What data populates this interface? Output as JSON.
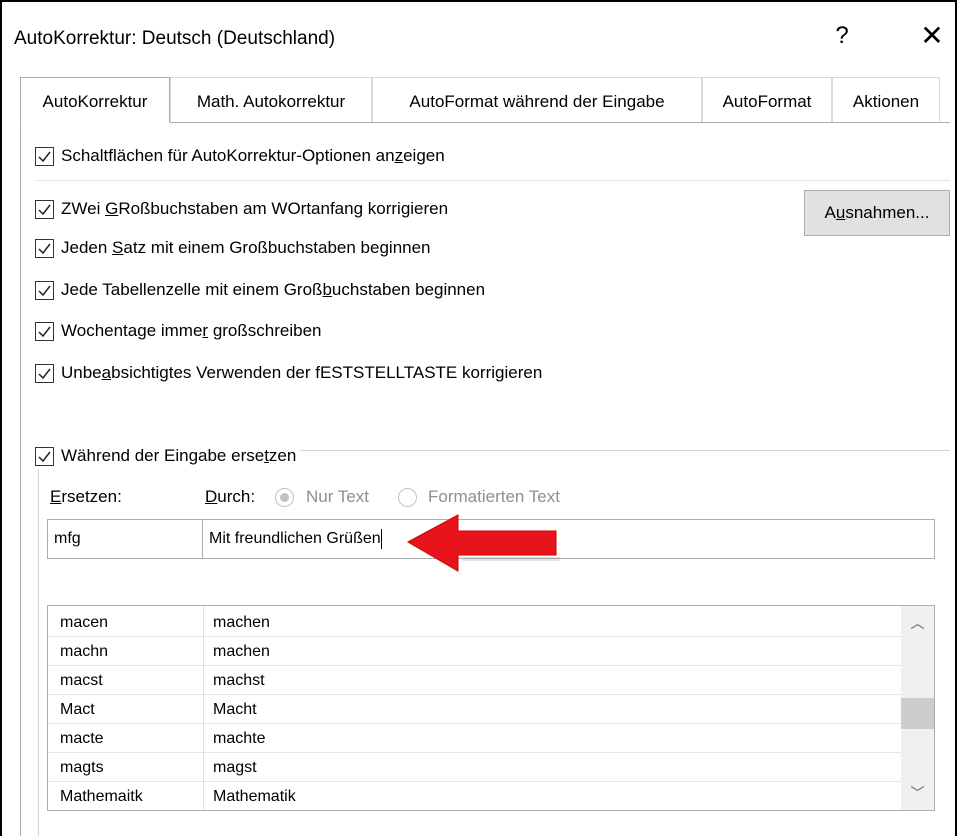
{
  "window": {
    "title": "AutoKorrektur: Deutsch (Deutschland)",
    "help_glyph": "?",
    "close_glyph": "✕"
  },
  "tabs": [
    {
      "label": "AutoKorrektur",
      "active": true
    },
    {
      "label": "Math. Autokorrektur"
    },
    {
      "label": "AutoFormat während der Eingabe"
    },
    {
      "label": "AutoFormat"
    },
    {
      "label": "Aktionen"
    }
  ],
  "options": {
    "show_buttons": {
      "pre": "Schaltflächen für AutoKorrektur-Optionen an",
      "key": "z",
      "post": "eigen",
      "checked": true
    },
    "two_caps": {
      "pre": "ZWei ",
      "key": "G",
      "post": "Roßbuchstaben am WOrtanfang korrigieren",
      "checked": true
    },
    "sentence": {
      "pre": "Jeden ",
      "key": "S",
      "post": "atz mit einem Großbuchstaben beginnen",
      "checked": true
    },
    "table_cell": {
      "pre": "Jede Tabellenzelle mit einem Groß",
      "key": "b",
      "post": "uchstaben beginnen",
      "checked": true
    },
    "weekdays": {
      "pre": "Wochentage imme",
      "key": "r",
      "post": " großschreiben",
      "checked": true
    },
    "caps_lock": {
      "pre": "Unbe",
      "key": "a",
      "post": "bsichtigtes Verwenden der fESTSTELLTASTE korrigieren",
      "checked": true
    },
    "replace_typing": {
      "pre": "Während der Eingabe erse",
      "key": "t",
      "post": "zen",
      "checked": true
    }
  },
  "exceptions_button": {
    "pre": "A",
    "key": "u",
    "post": "snahmen..."
  },
  "replace": {
    "label_key": "E",
    "label_rest": "rsetzen:",
    "with_key": "D",
    "with_rest": "urch:",
    "radio_plain": "Nur Text",
    "radio_formatted": "Formatierten Text",
    "replace_value": "mfg",
    "with_value": "Mit freundlichen Grüßen"
  },
  "entries": [
    {
      "from": "macen",
      "to": "machen"
    },
    {
      "from": "machn",
      "to": "machen"
    },
    {
      "from": "macst",
      "to": "machst"
    },
    {
      "from": "Mact",
      "to": "Macht"
    },
    {
      "from": "macte",
      "to": "machte"
    },
    {
      "from": "magts",
      "to": "magst"
    },
    {
      "from": "Mathemaitk",
      "to": "Mathematik"
    }
  ],
  "scrollbar": {
    "up_glyph": "︿",
    "down_glyph": "﹀"
  },
  "colors": {
    "arrow": "#e8141b",
    "disabled": "#8f8f8f",
    "button_bg": "#e1e1e1"
  },
  "icons": {
    "checkbox_checked": "check-icon",
    "arrow": "red-arrow-left-icon"
  }
}
